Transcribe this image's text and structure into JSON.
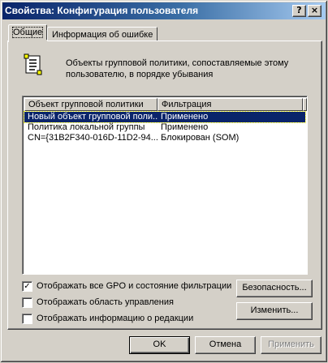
{
  "window": {
    "title": "Свойства: Конфигурация пользователя",
    "help_button": "?",
    "close_button": "×"
  },
  "tabs": [
    {
      "label": "Общие",
      "active": true
    },
    {
      "label": "Информация об ошибке",
      "active": false
    }
  ],
  "general": {
    "description": "Объекты групповой политики, сопоставляемые этому пользователю, в порядке убывания",
    "icon": "scroll-policy-icon",
    "list": {
      "columns": [
        "Объект групповой политики",
        "Фильтрация"
      ],
      "rows": [
        {
          "name": "Новый объект групповой поли...",
          "filter": "Применено",
          "selected": true
        },
        {
          "name": "Политика локальной группы",
          "filter": "Применено",
          "selected": false
        },
        {
          "name": "CN={31B2F340-016D-11D2-94...",
          "filter": "Блокирован (SOM)",
          "selected": false
        }
      ]
    },
    "checkboxes": [
      {
        "label": "Отображать все GPO и состояние фильтрации",
        "checked": true
      },
      {
        "label": "Отображать область управления",
        "checked": false
      },
      {
        "label": "Отображать информацию о редакции",
        "checked": false
      }
    ],
    "security_button": "Безопасность...",
    "change_button": "Изменить..."
  },
  "footer": {
    "ok": "OK",
    "cancel": "Отмена",
    "apply": "Применить"
  },
  "colors": {
    "titlebar_start": "#0a246a",
    "titlebar_end": "#a6caf0",
    "face": "#d4d0c8",
    "selection": "#0a246a"
  }
}
